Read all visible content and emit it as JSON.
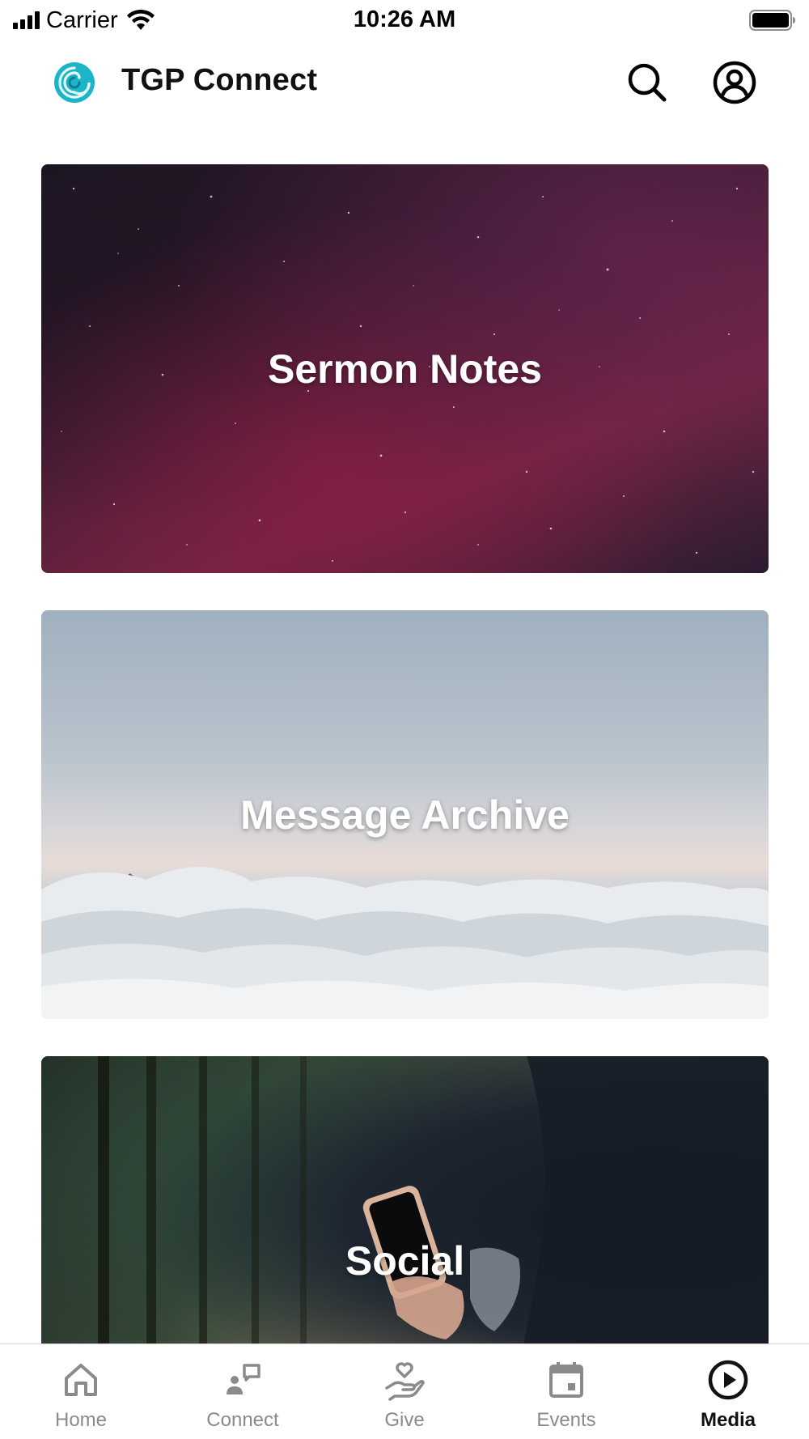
{
  "status_bar": {
    "carrier": "Carrier",
    "time": "10:26 AM"
  },
  "header": {
    "title": "TGP Connect",
    "logo_color": "#1ab5c8"
  },
  "cards": [
    {
      "label": "Sermon Notes"
    },
    {
      "label": "Message Archive"
    },
    {
      "label": "Social"
    }
  ],
  "tabs": [
    {
      "label": "Home",
      "icon": "home-icon"
    },
    {
      "label": "Connect",
      "icon": "connect-icon"
    },
    {
      "label": "Give",
      "icon": "give-icon"
    },
    {
      "label": "Events",
      "icon": "calendar-icon"
    },
    {
      "label": "Media",
      "icon": "play-icon",
      "active": true
    }
  ],
  "colors": {
    "tab_inactive": "#8a8a8a",
    "tab_active": "#111111"
  }
}
